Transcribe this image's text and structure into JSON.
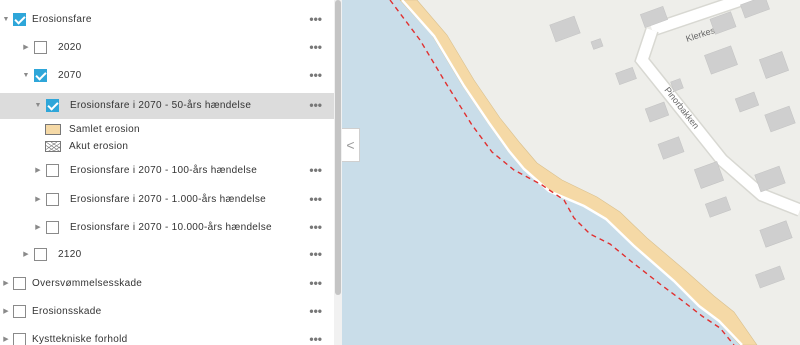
{
  "layers": {
    "erosion_group": {
      "label": "Erosionsfare",
      "checked": true
    },
    "y2020": {
      "label": "2020",
      "checked": false
    },
    "y2070": {
      "label": "2070",
      "checked": true
    },
    "y2070_50": {
      "label": "Erosionsfare i 2070 - 50-års hændelse",
      "checked": true
    },
    "legend": {
      "samlet": "Samlet erosion",
      "akut": "Akut erosion"
    },
    "y2070_100": {
      "label": "Erosionsfare i 2070 - 100-års hændelse",
      "checked": false
    },
    "y2070_1000": {
      "label": "Erosionsfare i 2070 - 1.000-års hændelse",
      "checked": false
    },
    "y2070_10000": {
      "label": "Erosionsfare i 2070 - 10.000-års hændelse",
      "checked": false
    },
    "y2120": {
      "label": "2120",
      "checked": false
    },
    "oversvommelse": {
      "label": "Oversvømmelsesskade",
      "checked": false
    },
    "erosionsskade": {
      "label": "Erosionsskade",
      "checked": false
    },
    "kysttekniske": {
      "label": "Kysttekniske forhold",
      "checked": false
    }
  },
  "more_label": "•••",
  "collapse_label": "<",
  "map": {
    "streets": [
      "Klerkestien",
      "Pinorbakken"
    ],
    "colors": {
      "land": "#eeeeea",
      "water": "#c9dde9",
      "erosion": "#f5d9a6",
      "building": "#cfcfcf",
      "line": "#e03030"
    }
  }
}
